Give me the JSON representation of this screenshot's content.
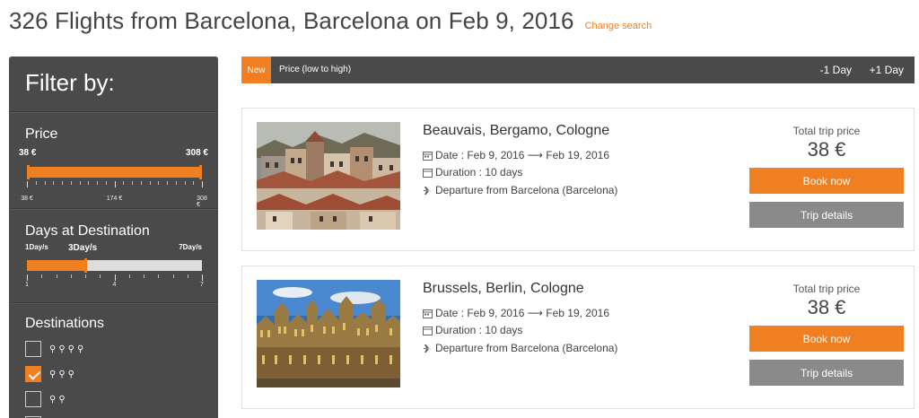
{
  "header": {
    "title": "326 Flights from Barcelona, Barcelona on Feb 9, 2016",
    "change_search": "Change search"
  },
  "sidebar": {
    "title": "Filter by:",
    "price": {
      "heading": "Price",
      "min_label": "38 €",
      "max_label": "308 €",
      "ticks": [
        "38 €",
        "174 €",
        "308 €"
      ],
      "selected_min_fraction": 0.0,
      "selected_max_fraction": 1.0
    },
    "days": {
      "heading": "Days at Destination",
      "min_label": "1Day/s",
      "current_label": "3Day/s",
      "max_label": "7Day/s",
      "ticks": [
        "1",
        "4",
        "7"
      ],
      "current_value": 3,
      "range_min": 1,
      "range_max": 7
    },
    "destinations": {
      "heading": "Destinations",
      "options": [
        {
          "pins": "⚲⚲⚲⚲",
          "checked": false
        },
        {
          "pins": "⚲⚲⚲",
          "checked": true
        },
        {
          "pins": "⚲⚲",
          "checked": false
        }
      ]
    }
  },
  "sort_bar": {
    "new_tag": "New",
    "sort_label": "Price (low to high)",
    "minus_day": "-1 Day",
    "plus_day": "+1 Day"
  },
  "results": [
    {
      "route": "Beauvais, Bergamo, Cologne",
      "date": "Date : Feb 9, 2016 ⟶ Feb 19, 2016",
      "duration": "Duration : 10 days",
      "departure": "Departure from Barcelona (Barcelona)",
      "price_caption": "Total trip price",
      "price": "38 €",
      "book_label": "Book now",
      "details_label": "Trip details"
    },
    {
      "route": "Brussels, Berlin, Cologne",
      "date": "Date : Feb 9, 2016 ⟶ Feb 19, 2016",
      "duration": "Duration : 10 days",
      "departure": "Departure from Barcelona (Barcelona)",
      "price_caption": "Total trip price",
      "price": "38 €",
      "book_label": "Book now",
      "details_label": "Trip details"
    }
  ],
  "colors": {
    "accent": "#f07f22",
    "sidebar_bg": "#4a4a4a",
    "details_button": "#8a8a8a"
  }
}
